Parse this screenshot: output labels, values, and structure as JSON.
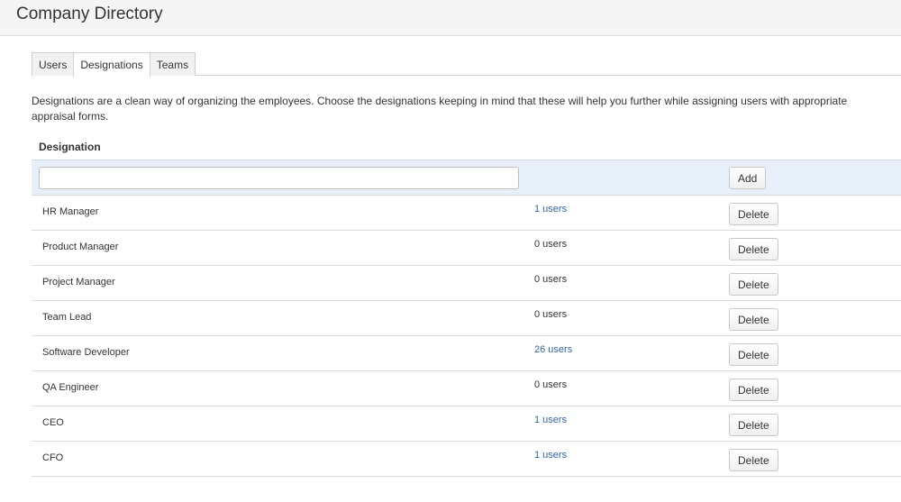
{
  "header": {
    "title": "Company Directory"
  },
  "tabs": [
    {
      "label": "Users",
      "active": false
    },
    {
      "label": "Designations",
      "active": true
    },
    {
      "label": "Teams",
      "active": false
    }
  ],
  "description": "Designations are a clean way of organizing the employees. Choose the designations keeping in mind that these will help you further while assigning users with appropriate appraisal forms.",
  "table": {
    "header": "Designation",
    "add_input": {
      "value": "",
      "placeholder": ""
    },
    "add_button": "Add",
    "delete_label": "Delete",
    "rows": [
      {
        "name": "HR Manager",
        "users": "1 users",
        "link": true
      },
      {
        "name": "Product Manager",
        "users": "0 users",
        "link": false
      },
      {
        "name": "Project Manager",
        "users": "0 users",
        "link": false
      },
      {
        "name": "Team Lead",
        "users": "0 users",
        "link": false
      },
      {
        "name": "Software Developer",
        "users": "26 users",
        "link": true
      },
      {
        "name": "QA Engineer",
        "users": "0 users",
        "link": false
      },
      {
        "name": "CEO",
        "users": "1 users",
        "link": true
      },
      {
        "name": "CFO",
        "users": "1 users",
        "link": true
      }
    ]
  },
  "colors": {
    "link": "#3465a4",
    "add_row_bg": "#e7eff8",
    "header_bg": "#f5f5f5"
  }
}
